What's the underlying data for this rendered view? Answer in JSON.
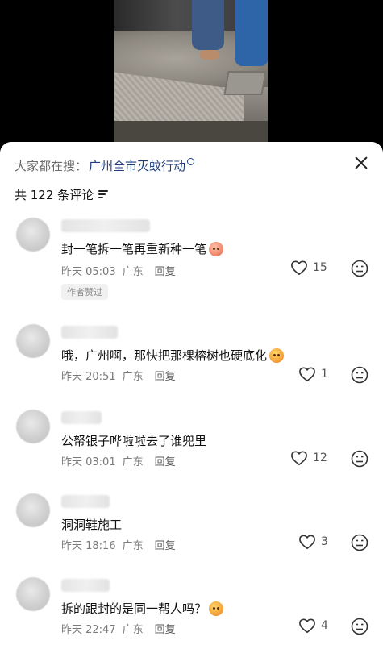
{
  "search": {
    "prefix": "大家都在搜：",
    "term": "广州全市灭蚊行动"
  },
  "header": {
    "count_label": "共 122 条评论"
  },
  "comments": [
    {
      "text": "封一笔拆一笔再重新种一笔",
      "emoji": "pink-face-emoji",
      "time": "昨天 05:03",
      "location": "广东",
      "reply_label": "回复",
      "likes": "15",
      "badge": "作者赞过"
    },
    {
      "text": "哦，广州啊，那快把那棵榕树也硬底化",
      "emoji": "orange-face-emoji",
      "time": "昨天 20:51",
      "location": "广东",
      "reply_label": "回复",
      "likes": "1"
    },
    {
      "text": "公帑银子哗啦啦去了谁兜里",
      "time": "昨天 03:01",
      "location": "广东",
      "reply_label": "回复",
      "likes": "12"
    },
    {
      "text": "洞洞鞋施工",
      "time": "昨天 18:16",
      "location": "广东",
      "reply_label": "回复",
      "likes": "3"
    },
    {
      "text": "拆的跟封的是同一帮人吗？",
      "emoji": "orange-face-emoji",
      "time": "昨天 22:47",
      "location": "广东",
      "reply_label": "回复",
      "likes": "4"
    }
  ]
}
